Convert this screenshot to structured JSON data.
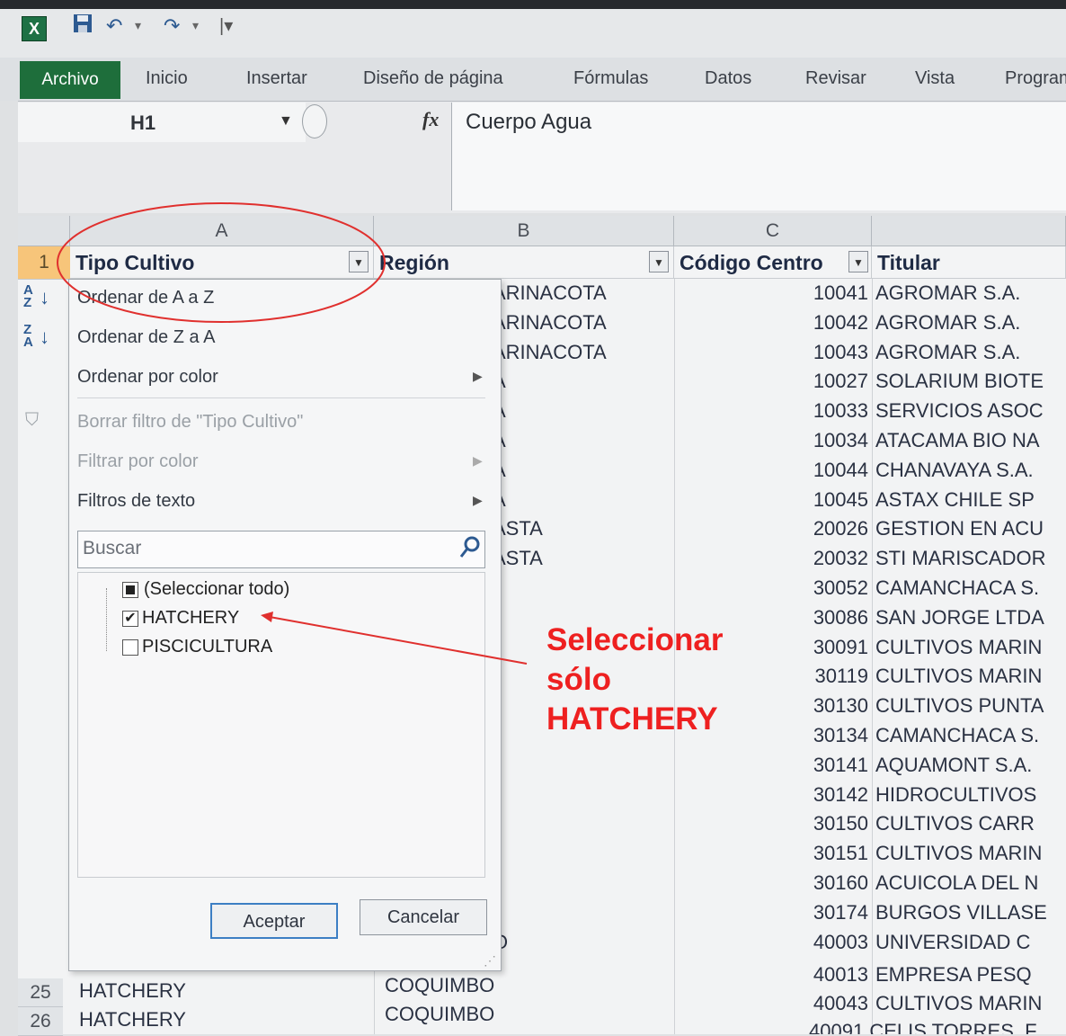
{
  "qat": {
    "logo": "X",
    "icons": [
      "save-icon",
      "undo-icon",
      "redo-icon",
      "customize-icon"
    ]
  },
  "ribbon": {
    "file_tab": "Archivo",
    "tabs": [
      "Inicio",
      "Insertar",
      "Diseño de página",
      "Fórmulas",
      "Datos",
      "Revisar",
      "Vista",
      "Program"
    ]
  },
  "formula_bar": {
    "name_box": "H1",
    "fx": "fx",
    "content": "Cuerpo Agua"
  },
  "columns": [
    "A",
    "B",
    "C"
  ],
  "header_row": {
    "row_number": "1",
    "a": "Tipo Cultivo",
    "b": "Región",
    "c": "Código Centro",
    "d": "Titular"
  },
  "rows": [
    {
      "region": "ARINACOTA",
      "code": "10041",
      "titular": "AGROMAR S.A."
    },
    {
      "region": "ARINACOTA",
      "code": "10042",
      "titular": "AGROMAR S.A."
    },
    {
      "region": "ARINACOTA",
      "code": "10043",
      "titular": "AGROMAR S.A."
    },
    {
      "region": "A",
      "code": "10027",
      "titular": "SOLARIUM BIOTE"
    },
    {
      "region": "A",
      "code": "10033",
      "titular": "SERVICIOS ASOC"
    },
    {
      "region": "A",
      "code": "10034",
      "titular": "ATACAMA BIO NA"
    },
    {
      "region": "A",
      "code": "10044",
      "titular": "CHANAVAYA S.A."
    },
    {
      "region": "A",
      "code": "10045",
      "titular": "ASTAX CHILE SP"
    },
    {
      "region": "ASTA",
      "code": "20026",
      "titular": "GESTION EN ACU"
    },
    {
      "region": "ASTA",
      "code": "20032",
      "titular": "STI MARISCADOR"
    },
    {
      "region": "",
      "code": "30052",
      "titular": "CAMANCHACA S."
    },
    {
      "region": "",
      "code": "30086",
      "titular": "SAN JORGE LTDA"
    },
    {
      "region": "",
      "code": "30091",
      "titular": "CULTIVOS MARIN"
    },
    {
      "region": "",
      "code": "30119",
      "titular": "CULTIVOS MARIN"
    },
    {
      "region": "",
      "code": "30130",
      "titular": "CULTIVOS PUNTA"
    },
    {
      "region": "",
      "code": "30134",
      "titular": "CAMANCHACA S."
    },
    {
      "region": "",
      "code": "30141",
      "titular": "AQUAMONT S.A."
    },
    {
      "region": "",
      "code": "30142",
      "titular": "HIDROCULTIVOS"
    },
    {
      "region": "",
      "code": "30150",
      "titular": "CULTIVOS CARR"
    },
    {
      "region": "",
      "code": "30151",
      "titular": "CULTIVOS MARIN"
    },
    {
      "region": "",
      "code": "30160",
      "titular": "ACUICOLA DEL N"
    },
    {
      "region": "",
      "code": "30174",
      "titular": "BURGOS VILLASE"
    },
    {
      "region": "O",
      "code": "40003",
      "titular": "UNIVERSIDAD C"
    }
  ],
  "visible_rows": [
    {
      "num": "25",
      "tipo": "HATCHERY",
      "region": "COQUIMBO",
      "code": "40013",
      "titular": "EMPRESA PESQ"
    },
    {
      "num": "26",
      "tipo": "HATCHERY",
      "region": "COQUIMBO",
      "code": "40043",
      "titular": "CULTIVOS MARIN"
    }
  ],
  "last_partial": {
    "code": "40091",
    "titular": "CELIS TORRES, F"
  },
  "filter_menu": {
    "sort_az": "Ordenar de A a Z",
    "sort_za": "Ordenar de Z a A",
    "sort_color": "Ordenar por color",
    "clear_filter": "Borrar filtro de \"Tipo Cultivo\"",
    "filter_color": "Filtrar por color",
    "text_filters": "Filtros de texto",
    "search_placeholder": "Buscar",
    "select_all": "(Seleccionar todo)",
    "options": [
      {
        "label": "HATCHERY",
        "checked": true
      },
      {
        "label": "PISCICULTURA",
        "checked": false
      }
    ],
    "ok": "Aceptar",
    "cancel": "Cancelar"
  },
  "annotation": {
    "line1": "Seleccionar",
    "line2": "sólo",
    "line3": "HATCHERY",
    "color": "#ee2020"
  }
}
